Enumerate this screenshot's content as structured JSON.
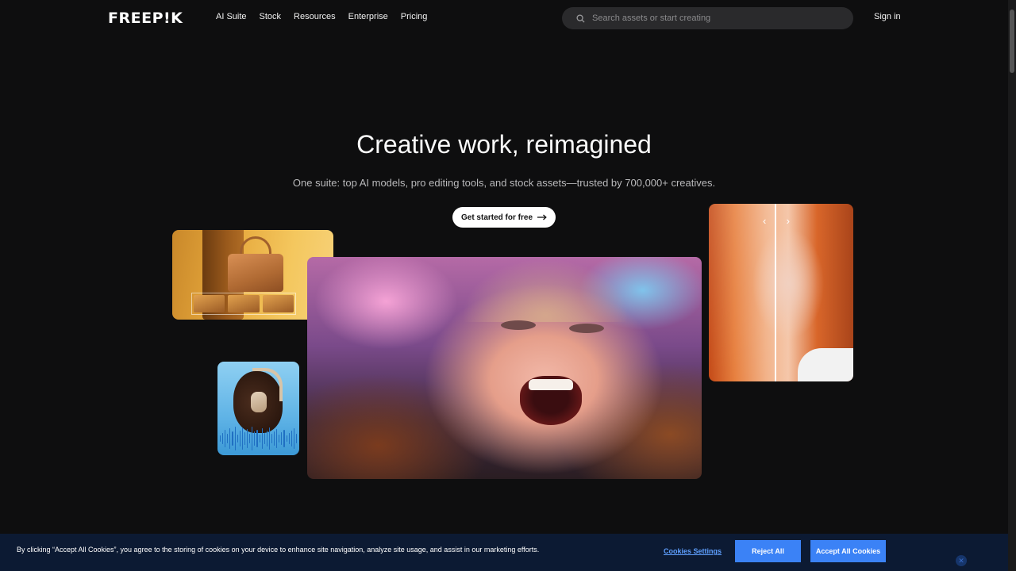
{
  "header": {
    "logo": "FREEP!K",
    "nav": [
      "AI Suite",
      "Stock",
      "Resources",
      "Enterprise",
      "Pricing"
    ],
    "search_placeholder": "Search assets or start creating",
    "signin": "Sign in"
  },
  "hero": {
    "title": "Creative work, reimagined",
    "subtitle": "One suite: top AI models, pro editing tools, and stock assets—trusted by 700,000+ creatives.",
    "cta": "Get started for free"
  },
  "cookie": {
    "text": "By clicking “Accept All Cookies”, you agree to the storing of cookies on your device to enhance site navigation, analyze site usage, and assist in our marketing efforts.",
    "settings": "Cookies Settings",
    "reject": "Reject All",
    "accept": "Accept All Cookies"
  },
  "colors": {
    "background": "#0e0e0f",
    "cookie_banner": "#0c1a33",
    "cookie_button": "#3b82f6"
  },
  "icons": [
    "search-icon",
    "arrow-right-icon",
    "chevron-left-icon",
    "chevron-right-icon",
    "close-icon"
  ]
}
